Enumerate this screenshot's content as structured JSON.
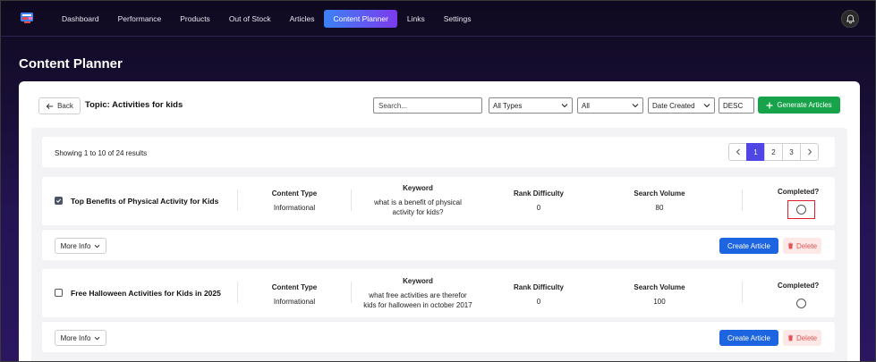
{
  "nav": {
    "items": [
      {
        "label": "Dashboard",
        "active": false
      },
      {
        "label": "Performance",
        "active": false
      },
      {
        "label": "Products",
        "active": false
      },
      {
        "label": "Out of Stock",
        "active": false
      },
      {
        "label": "Articles",
        "active": false
      },
      {
        "label": "Content Planner",
        "active": true
      },
      {
        "label": "Links",
        "active": false
      },
      {
        "label": "Settings",
        "active": false
      }
    ],
    "bell_icon": "bell-icon"
  },
  "page": {
    "title": "Content Planner"
  },
  "toolbar": {
    "back_label": "Back",
    "topic_title": "Topic: Activities for kids",
    "search_placeholder": "Search...",
    "type_filter": "All Types",
    "status_filter": "All",
    "sort_field": "Date Created",
    "sort_order": "DESC",
    "generate_label": "Generate Articles"
  },
  "results": {
    "summary": "Showing 1 to 10 of 24 results",
    "pages": [
      "1",
      "2",
      "3"
    ],
    "current_page": "1"
  },
  "columns": {
    "content_type": "Content Type",
    "keyword": "Keyword",
    "rank_difficulty": "Rank Difficulty",
    "search_volume": "Search Volume",
    "completed": "Completed?"
  },
  "articles": [
    {
      "title": "Top Benefits of Physical Activity for Kids",
      "selected": true,
      "content_type": "Informational",
      "keyword_line1": "what is a benefit of physical",
      "keyword_line2": "activity for kids?",
      "rank_difficulty": "0",
      "search_volume": "80",
      "more_info_label": "More Info",
      "create_label": "Create Article",
      "delete_label": "Delete"
    },
    {
      "title": "Free Halloween Activities for Kids in 2025",
      "selected": false,
      "content_type": "Informational",
      "keyword_line1": "what free activities are therefor",
      "keyword_line2": "kids for halloween in october 2017",
      "rank_difficulty": "0",
      "search_volume": "100",
      "more_info_label": "More Info",
      "create_label": "Create Article",
      "delete_label": "Delete"
    }
  ],
  "colors": {
    "accent": "#4f46e5",
    "generate": "#16a34a",
    "create": "#1d64e0",
    "delete_bg": "#fde8e8",
    "highlight": "#e11d2e"
  }
}
